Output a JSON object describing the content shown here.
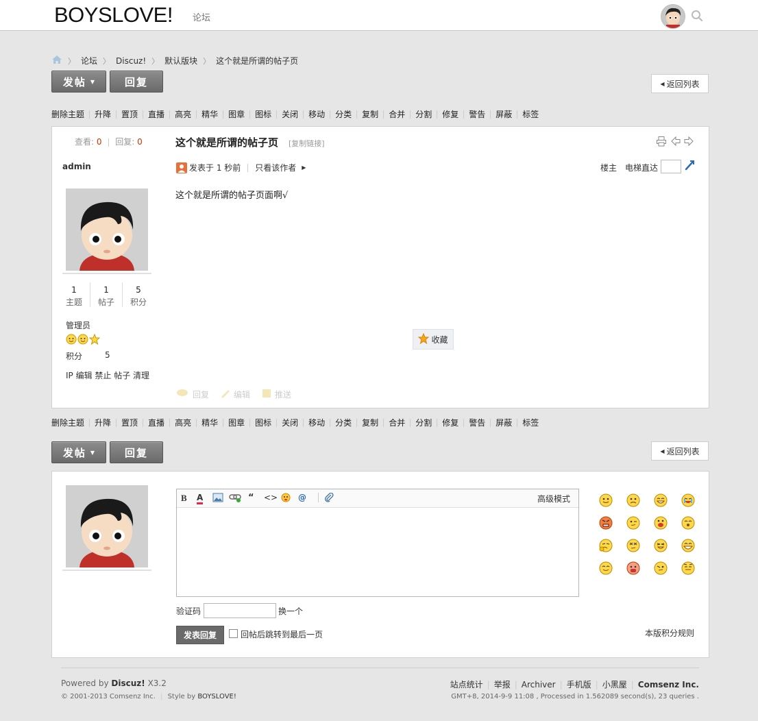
{
  "header": {
    "logo": "BOYSLOVE!",
    "nav_forum": "论坛"
  },
  "breadcrumb": {
    "items": [
      "论坛",
      "Discuz!",
      "默认版块",
      "这个就是所谓的帖子页"
    ]
  },
  "actions": {
    "post_label": "发帖",
    "reply_label": "回复",
    "back_label": "返回列表"
  },
  "modbar": {
    "items": [
      "删除主题",
      "升降",
      "置顶",
      "直播",
      "高亮",
      "精华",
      "图章",
      "图标",
      "关闭",
      "移动",
      "分类",
      "复制",
      "合并",
      "分割",
      "修复",
      "警告",
      "屏蔽",
      "标签"
    ]
  },
  "thread": {
    "views_label": "查看:",
    "views": "0",
    "replies_label": "回复:",
    "replies": "0",
    "title": "这个就是所谓的帖子页",
    "copy_link": "[复制链接]",
    "author": "admin",
    "posted": "发表于 1 秒前",
    "only_author": "只看该作者",
    "floor": "楼主",
    "elevator": "电梯直达",
    "content": "这个就是所谓的帖子页面啊√",
    "favorite": "收藏",
    "reply_action": "回复",
    "edit_action": "编辑",
    "push_action": "推送"
  },
  "author_info": {
    "stats": [
      {
        "value": "1",
        "label": "主题"
      },
      {
        "value": "1",
        "label": "帖子"
      },
      {
        "value": "5",
        "label": "积分"
      }
    ],
    "group": "管理员",
    "credit_label": "积分",
    "credit_value": "5",
    "admin_links": "IP 编辑 禁止 帖子 清理"
  },
  "reply_form": {
    "advanced_mode": "高级模式",
    "captcha_label": "验证码",
    "captcha_change": "换一个",
    "submit": "发表回复",
    "jump_last": "回帖后跳转到最后一页",
    "credit_rules": "本版积分规则"
  },
  "footer": {
    "powered_prefix": "Powered by",
    "powered_name": "Discuz!",
    "version": "X3.2",
    "copyright": "© 2001-2013 Comsenz Inc.",
    "style_by": "Style by",
    "style_name": "BOYSLOVE!",
    "links": [
      "站点统计",
      "举报",
      "Archiver",
      "手机版",
      "小黑屋"
    ],
    "company": "Comsenz Inc.",
    "processed": "GMT+8, 2014-9-9 11:08 , Processed in 1.562089 second(s), 23 queries ."
  },
  "colors": {
    "accent_red": "#cc3300",
    "link_blue": "#336699",
    "button_dark": "#777777"
  }
}
